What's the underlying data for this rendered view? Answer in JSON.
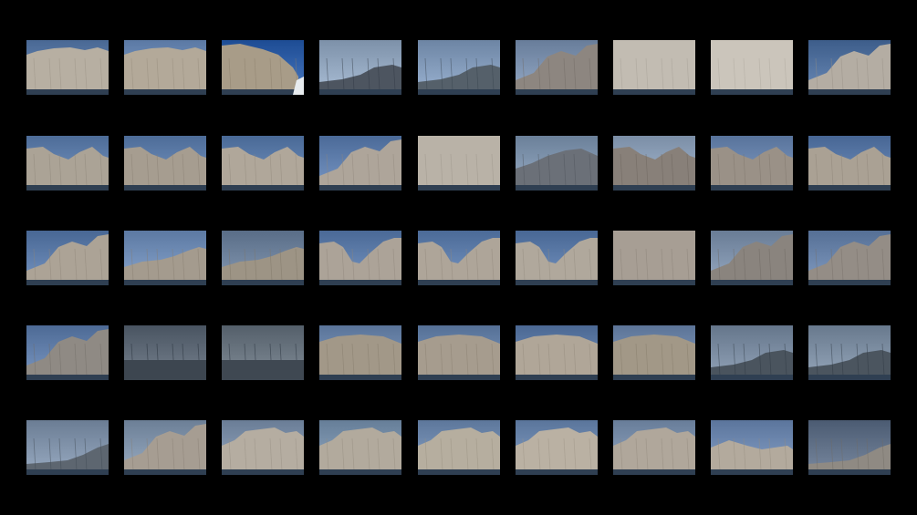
{
  "sheet": {
    "background": "#000000",
    "rows": 5,
    "columns": 9
  },
  "thumbnails": [
    [
      {
        "scene": "cliff-close",
        "sky": "#5b7aa6",
        "rock": "#b7afa2"
      },
      {
        "scene": "cliff-close",
        "sky": "#6d8bb6",
        "rock": "#b3a999"
      },
      {
        "scene": "cliff-boat",
        "sky": "#2f5ea6",
        "rock": "#a89c88"
      },
      {
        "scene": "distant-headland",
        "sky": "#8fa3bb",
        "rock": "#4d5560"
      },
      {
        "scene": "distant-headland",
        "sky": "#7f97b6",
        "rock": "#55606a"
      },
      {
        "scene": "cliff-right",
        "sky": "#7a8fac",
        "rock": "#8d8680"
      },
      {
        "scene": "rock-face",
        "sky": "#9aa3ab",
        "rock": "#c2bcb2"
      },
      {
        "scene": "rock-face",
        "sky": "#a7adb2",
        "rock": "#cbc5bb"
      },
      {
        "scene": "cliff-right",
        "sky": "#4f6f9c",
        "rock": "#b4ada3"
      }
    ],
    [
      {
        "scene": "ridge",
        "sky": "#5f7eaa",
        "rock": "#aba396"
      },
      {
        "scene": "ridge",
        "sky": "#5f7eaa",
        "rock": "#a69d90"
      },
      {
        "scene": "ridge",
        "sky": "#5b7ba8",
        "rock": "#b0a79a"
      },
      {
        "scene": "cliff-right",
        "sky": "#5d7caa",
        "rock": "#aea59a"
      },
      {
        "scene": "rock-face",
        "sky": "#6b88b2",
        "rock": "#b9b2a7"
      },
      {
        "scene": "ridge-dark",
        "sky": "#7d92ab",
        "rock": "#6b7078"
      },
      {
        "scene": "ridge",
        "sky": "#8da0b8",
        "rock": "#888079"
      },
      {
        "scene": "ridge",
        "sky": "#6a85ad",
        "rock": "#9a9187"
      },
      {
        "scene": "ridge",
        "sky": "#5978a6",
        "rock": "#aaa194"
      }
    ],
    [
      {
        "scene": "cliff-right",
        "sky": "#5a79a6",
        "rock": "#aca396"
      },
      {
        "scene": "ridge-far",
        "sky": "#6e8bb4",
        "rock": "#a49b8e"
      },
      {
        "scene": "ridge-far",
        "sky": "#6b7f99",
        "rock": "#9d9485"
      },
      {
        "scene": "double-peak",
        "sky": "#5c7ba8",
        "rock": "#aca398"
      },
      {
        "scene": "double-peak",
        "sky": "#5d7ca9",
        "rock": "#aea599"
      },
      {
        "scene": "double-peak",
        "sky": "#5a79a6",
        "rock": "#b0a89c"
      },
      {
        "scene": "rock-face",
        "sky": "#627ea7",
        "rock": "#a79e94"
      },
      {
        "scene": "cliff-right",
        "sky": "#7b8ea7",
        "rock": "#8a847e"
      },
      {
        "scene": "cliff-right",
        "sky": "#6781a7",
        "rock": "#948d86"
      }
    ],
    [
      {
        "scene": "cliff-right",
        "sky": "#5f7ca7",
        "rock": "#8f8a84"
      },
      {
        "scene": "sea-cloudy",
        "sky": "#5b6673",
        "rock": "#3d4650"
      },
      {
        "scene": "sea-cloudy",
        "sky": "#66717c",
        "rock": "#3f4852"
      },
      {
        "scene": "rock-face-low",
        "sky": "#6c86ab",
        "rock": "#a29888"
      },
      {
        "scene": "rock-face-low",
        "sky": "#6782a8",
        "rock": "#a69c8e"
      },
      {
        "scene": "rock-face-low",
        "sky": "#5d7aa5",
        "rock": "#b0a698"
      },
      {
        "scene": "rock-face-low",
        "sky": "#6e86a9",
        "rock": "#a29887"
      },
      {
        "scene": "distant-headland",
        "sky": "#77889d",
        "rock": "#4a545e"
      },
      {
        "scene": "distant-headland",
        "sky": "#7a8b9f",
        "rock": "#4b555f"
      }
    ],
    [
      {
        "scene": "distant-ridge-low",
        "sky": "#7d8fa6",
        "rock": "#5d6670"
      },
      {
        "scene": "cliff-right",
        "sky": "#7e91a8",
        "rock": "#a69d92"
      },
      {
        "scene": "ridge-wide",
        "sky": "#7c8fa8",
        "rock": "#b5ada1"
      },
      {
        "scene": "ridge-wide",
        "sky": "#7890aa",
        "rock": "#b2aa9d"
      },
      {
        "scene": "ridge-wide",
        "sky": "#6f89ad",
        "rock": "#b6ae9f"
      },
      {
        "scene": "ridge-wide",
        "sky": "#6c87ad",
        "rock": "#bab1a3"
      },
      {
        "scene": "ridge-wide",
        "sky": "#7a8fab",
        "rock": "#b0a79b"
      },
      {
        "scene": "ridge-wide-low",
        "sky": "#6d87ae",
        "rock": "#b3aa9d"
      },
      {
        "scene": "distant-ridge-low",
        "sky": "#5d6d84",
        "rock": "#8f8a83"
      }
    ]
  ]
}
